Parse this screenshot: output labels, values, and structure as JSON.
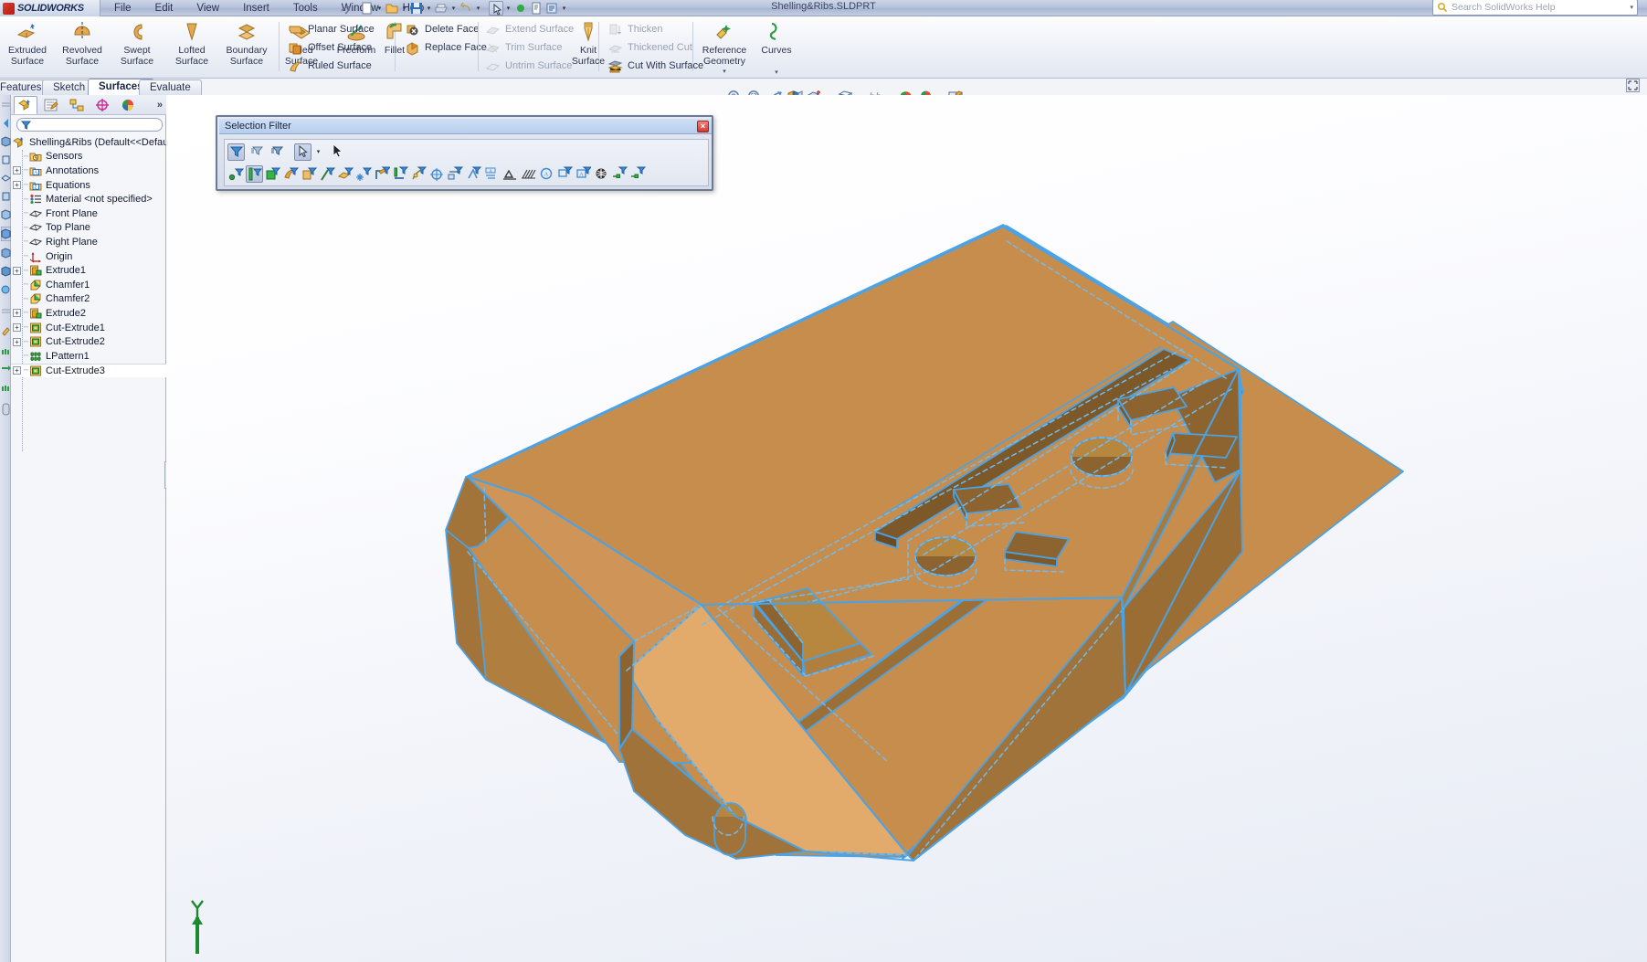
{
  "app": {
    "name": "SOLIDWORKS",
    "document_title": "Shelling&Ribs.SLDPRT"
  },
  "menu": {
    "items": [
      "File",
      "Edit",
      "View",
      "Insert",
      "Tools",
      "Window",
      "Help"
    ]
  },
  "quick_access": {
    "icons": [
      "new-document-icon",
      "open-icon",
      "save-icon",
      "print-icon",
      "undo-icon",
      "select-icon",
      "rebuild-icon",
      "file-properties-icon",
      "options-icon"
    ]
  },
  "search": {
    "placeholder": "Search SolidWorks Help",
    "icon": "search-icon",
    "dropdown_icon": "chevron-down-icon"
  },
  "ribbon": {
    "groups": [
      {
        "name": "surface-creation",
        "buttons": [
          {
            "label": "Extruded\nSurface",
            "label_line1": "Extruded",
            "label_line2": "Surface",
            "icon": "extruded-surface-icon",
            "enabled": true
          },
          {
            "label_line1": "Revolved",
            "label_line2": "Surface",
            "icon": "revolved-surface-icon",
            "enabled": true
          },
          {
            "label_line1": "Swept",
            "label_line2": "Surface",
            "icon": "swept-surface-icon",
            "enabled": true
          },
          {
            "label_line1": "Lofted",
            "label_line2": "Surface",
            "icon": "lofted-surface-icon",
            "enabled": true
          },
          {
            "label_line1": "Boundary",
            "label_line2": "Surface",
            "icon": "boundary-surface-icon",
            "enabled": true
          },
          {
            "label_line1": "Filled",
            "label_line2": "Surface",
            "icon": "filled-surface-icon",
            "enabled": true
          },
          {
            "label_line1": "Freeform",
            "label_line2": "",
            "icon": "freeform-icon",
            "enabled": true
          }
        ]
      },
      {
        "name": "planar-offset-ruled",
        "items": [
          {
            "label": "Planar Surface",
            "icon": "planar-surface-icon",
            "enabled": true
          },
          {
            "label": "Offset Surface",
            "icon": "offset-surface-icon",
            "enabled": true
          },
          {
            "label": "Ruled Surface",
            "icon": "ruled-surface-icon",
            "enabled": true
          }
        ]
      },
      {
        "name": "fillet",
        "button": {
          "label": "Fillet",
          "icon": "fillet-icon",
          "enabled": true
        }
      },
      {
        "name": "face-edit",
        "items": [
          {
            "label": "Delete Face",
            "icon": "delete-face-icon",
            "enabled": true
          },
          {
            "label": "Replace Face",
            "icon": "replace-face-icon",
            "enabled": true
          }
        ]
      },
      {
        "name": "extend-trim",
        "items": [
          {
            "label": "Extend Surface",
            "icon": "extend-surface-icon",
            "enabled": false
          },
          {
            "label": "Trim Surface",
            "icon": "trim-surface-icon",
            "enabled": false
          },
          {
            "label": "Untrim Surface",
            "icon": "untrim-surface-icon",
            "enabled": false
          }
        ]
      },
      {
        "name": "knit",
        "button": {
          "label_line1": "Knit",
          "label_line2": "Surface",
          "icon": "knit-surface-icon",
          "enabled": true
        }
      },
      {
        "name": "thicken",
        "items": [
          {
            "label": "Thicken",
            "icon": "thicken-icon",
            "enabled": false
          },
          {
            "label": "Thickened Cut",
            "icon": "thickened-cut-icon",
            "enabled": false
          },
          {
            "label": "Cut With Surface",
            "icon": "cut-with-surface-icon",
            "enabled": true
          }
        ]
      },
      {
        "name": "reference-curves",
        "buttons": [
          {
            "label_line1": "Reference",
            "label_line2": "Geometry",
            "icon": "reference-geometry-icon",
            "has_dropdown": true
          },
          {
            "label_line1": "Curves",
            "label_line2": "",
            "icon": "curves-icon",
            "has_dropdown": true
          }
        ]
      }
    ]
  },
  "tabs": [
    {
      "label": "Features",
      "active": false
    },
    {
      "label": "Sketch",
      "active": false
    },
    {
      "label": "Surfaces",
      "active": true
    },
    {
      "label": "Evaluate",
      "active": false
    }
  ],
  "feature_manager": {
    "tabs": [
      {
        "name": "feature-tree-tab",
        "icon": "feature-tree-icon",
        "selected": true
      },
      {
        "name": "property-manager-tab",
        "icon": "property-manager-icon",
        "selected": false
      },
      {
        "name": "configuration-manager-tab",
        "icon": "configuration-manager-icon",
        "selected": false
      },
      {
        "name": "dimxpert-tab",
        "icon": "dimxpert-icon",
        "selected": false
      },
      {
        "name": "display-manager-tab",
        "icon": "display-manager-icon",
        "selected": false
      }
    ],
    "more_label": "»",
    "filter": {
      "icon": "filter-icon",
      "value": "",
      "placeholder": ""
    },
    "tree": [
      {
        "label": "Shelling&Ribs  (Default<<Defau",
        "icon": "part-icon",
        "expandable": false,
        "depth": 0,
        "root": true
      },
      {
        "label": "Sensors",
        "icon": "sensors-icon",
        "expandable": false,
        "depth": 1
      },
      {
        "label": "Annotations",
        "icon": "annotations-icon",
        "expandable": true,
        "depth": 1
      },
      {
        "label": "Equations",
        "icon": "equations-icon",
        "expandable": true,
        "depth": 1
      },
      {
        "label": "Material <not specified>",
        "icon": "material-icon",
        "expandable": false,
        "depth": 1
      },
      {
        "label": "Front Plane",
        "icon": "plane-icon",
        "expandable": false,
        "depth": 1
      },
      {
        "label": "Top Plane",
        "icon": "plane-icon",
        "expandable": false,
        "depth": 1
      },
      {
        "label": "Right Plane",
        "icon": "plane-icon",
        "expandable": false,
        "depth": 1
      },
      {
        "label": "Origin",
        "icon": "origin-icon",
        "expandable": false,
        "depth": 1
      },
      {
        "label": "Extrude1",
        "icon": "extrude-icon",
        "expandable": true,
        "depth": 1
      },
      {
        "label": "Chamfer1",
        "icon": "chamfer-icon",
        "expandable": false,
        "depth": 1
      },
      {
        "label": "Chamfer2",
        "icon": "chamfer-icon",
        "expandable": false,
        "depth": 1
      },
      {
        "label": "Extrude2",
        "icon": "extrude-icon",
        "expandable": true,
        "depth": 1
      },
      {
        "label": "Cut-Extrude1",
        "icon": "cut-extrude-icon",
        "expandable": true,
        "depth": 1
      },
      {
        "label": "Cut-Extrude2",
        "icon": "cut-extrude-icon",
        "expandable": true,
        "depth": 1
      },
      {
        "label": "LPattern1",
        "icon": "linear-pattern-icon",
        "expandable": false,
        "depth": 1
      },
      {
        "label": "Cut-Extrude3",
        "icon": "cut-extrude-icon",
        "expandable": true,
        "depth": 1
      }
    ]
  },
  "view_toolbar": {
    "icons": [
      {
        "name": "zoom-to-fit-icon",
        "dropdown": false
      },
      {
        "name": "zoom-to-area-icon",
        "dropdown": false
      },
      {
        "name": "previous-view-icon",
        "dropdown": false
      },
      {
        "name": "section-view-icon",
        "dropdown": false
      },
      {
        "name": "view-orientation-icon",
        "dropdown": true
      },
      {
        "name": "display-style-icon",
        "dropdown": true
      },
      {
        "name": "hide-show-items-icon",
        "dropdown": true
      },
      {
        "name": "edit-appearance-icon",
        "dropdown": false
      },
      {
        "name": "apply-scene-icon",
        "dropdown": true
      },
      {
        "name": "view-settings-icon",
        "dropdown": true
      }
    ],
    "expand_icon": "expand-panel-icon"
  },
  "selection_filter": {
    "title": "Selection Filter",
    "close_label": "×",
    "row1": [
      {
        "name": "filter-toggle-button",
        "icon": "filter-on-icon",
        "active": true
      },
      {
        "name": "clear-all-filters-button",
        "icon": "clear-filters-icon",
        "active": false
      },
      {
        "name": "invert-selection-button",
        "icon": "invert-filters-icon",
        "active": false
      },
      {
        "name": "select-tool-button",
        "icon": "arrow-select-icon",
        "active": true
      },
      {
        "name": "select-tool-dropdown",
        "icon": "chevron-down-icon",
        "active": false
      },
      {
        "name": "cursor-pointer",
        "icon": "mouse-cursor-icon",
        "active": false
      }
    ],
    "row2": [
      {
        "name": "filter-vertices-button",
        "icon": "filter-vertex-icon",
        "active": false
      },
      {
        "name": "filter-edges-button",
        "icon": "filter-edge-icon",
        "active": true
      },
      {
        "name": "filter-faces-button",
        "icon": "filter-face-icon",
        "active": false
      },
      {
        "name": "filter-surface-bodies-button",
        "icon": "filter-surface-body-icon",
        "active": false
      },
      {
        "name": "filter-solid-bodies-button",
        "icon": "filter-solid-body-icon",
        "active": false
      },
      {
        "name": "filter-axes-button",
        "icon": "filter-axis-icon",
        "active": false
      },
      {
        "name": "filter-planes-button",
        "icon": "filter-plane-icon",
        "active": false
      },
      {
        "name": "filter-points-button",
        "icon": "filter-point-icon",
        "active": false
      },
      {
        "name": "filter-sketch-button",
        "icon": "filter-sketch-icon",
        "active": false
      },
      {
        "name": "filter-sketch-segments-button",
        "icon": "filter-sketch-segment-icon",
        "active": false
      },
      {
        "name": "filter-midpoints-button",
        "icon": "filter-midpoint-icon",
        "active": false
      },
      {
        "name": "filter-center-marks-button",
        "icon": "filter-center-mark-icon",
        "active": false
      },
      {
        "name": "filter-dimensions-button",
        "icon": "filter-dimension-icon",
        "active": false
      },
      {
        "name": "filter-surface-finish-button",
        "icon": "filter-surface-finish-icon",
        "active": false
      },
      {
        "name": "filter-weld-symbols-button",
        "icon": "filter-weld-icon",
        "active": false
      },
      {
        "name": "filter-datums-button",
        "icon": "filter-datum-icon",
        "active": false
      },
      {
        "name": "filter-notes-button",
        "icon": "filter-note-icon",
        "active": false
      },
      {
        "name": "filter-balloons-button",
        "icon": "filter-balloon-icon",
        "active": false
      },
      {
        "name": "filter-hatch-button",
        "icon": "filter-hatch-icon",
        "active": false
      },
      {
        "name": "filter-blocks-button",
        "icon": "filter-block-icon",
        "active": false
      },
      {
        "name": "filter-cosmetic-threads-button",
        "icon": "filter-cosmetic-thread-icon",
        "active": false
      },
      {
        "name": "filter-annotations-button",
        "icon": "filter-annotation-icon",
        "active": false
      },
      {
        "name": "filter-spheres-button",
        "icon": "filter-sphere-icon",
        "active": false
      },
      {
        "name": "filter-connection-points-button",
        "icon": "filter-connection-point-icon",
        "active": false
      },
      {
        "name": "filter-routing-points-button",
        "icon": "filter-routing-point-icon",
        "active": false
      }
    ]
  },
  "model": {
    "name": "shelling-and-ribs-part",
    "face_color": "#C98F4F",
    "face_color_light": "#E0A868",
    "face_color_dark": "#9A6D35",
    "edge_color": "#4AA3E6",
    "hidden_edge_color": "#6FBCF2",
    "triad_axis": "Y",
    "triad_color": "#1E8A2E"
  },
  "colors": {
    "ribbon_bg": "#eef1f7",
    "panel_bg": "#f4f6fa",
    "accent_blue": "#4AA3E6",
    "title_blue": "#b6cdec",
    "text": "#2c3550"
  }
}
